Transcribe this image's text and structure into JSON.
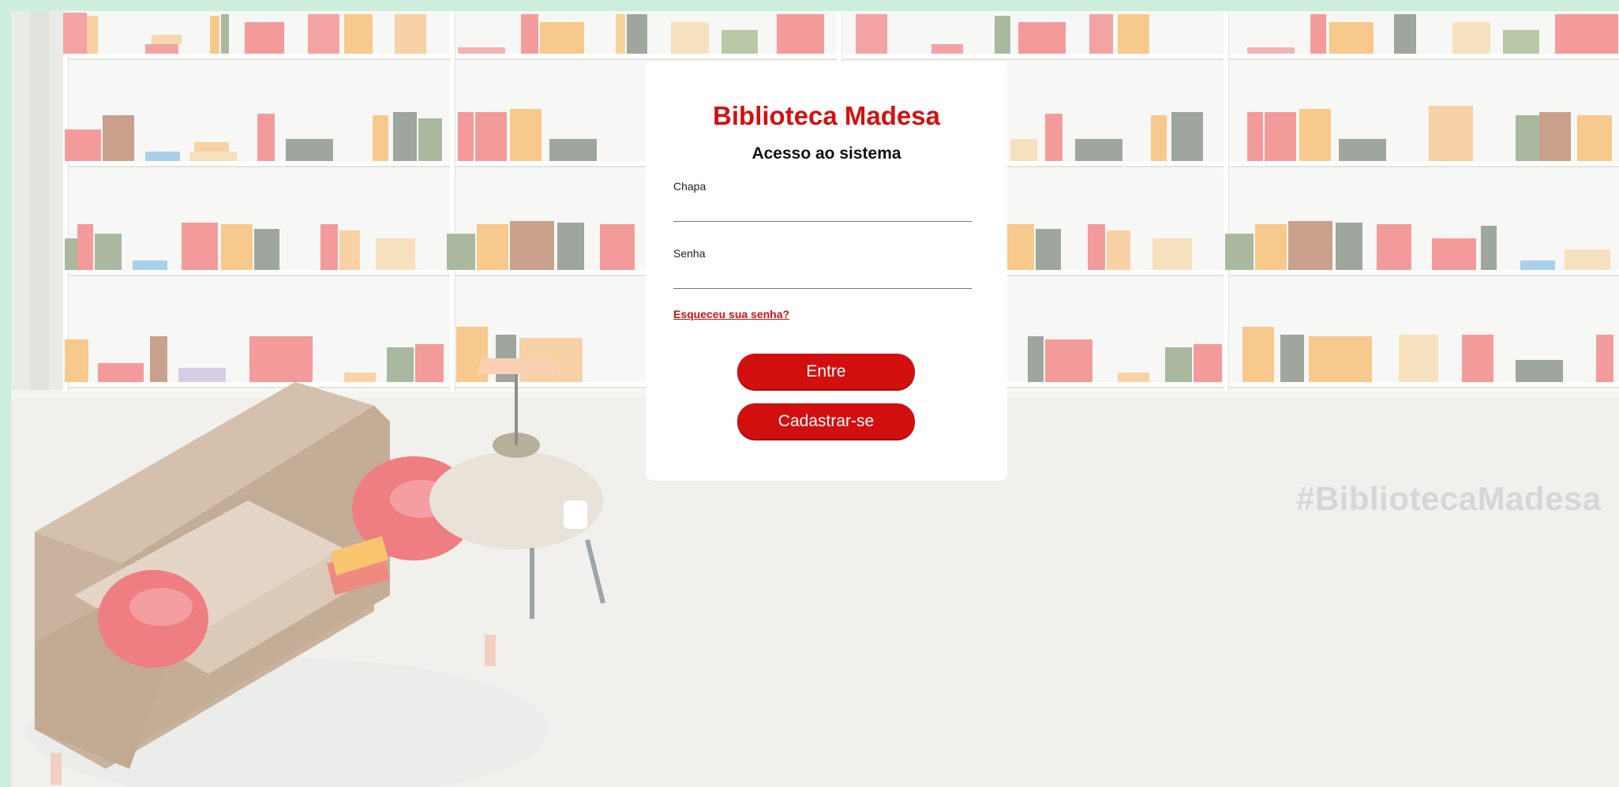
{
  "brand": {
    "title": "Biblioteca Madesa",
    "hashtag": "#BibliotecaMadesa"
  },
  "login": {
    "subtitle": "Acesso ao sistema",
    "chapa_label": "Chapa",
    "chapa_value": "",
    "senha_label": "Senha",
    "senha_value": "",
    "forgot_link": "Esqueceu sua senha?",
    "submit_label": "Entre",
    "register_label": "Cadastrar-se"
  },
  "colors": {
    "accent": "#d10f0f",
    "frame": "#cdeedd",
    "background": "#f4f4f1"
  }
}
